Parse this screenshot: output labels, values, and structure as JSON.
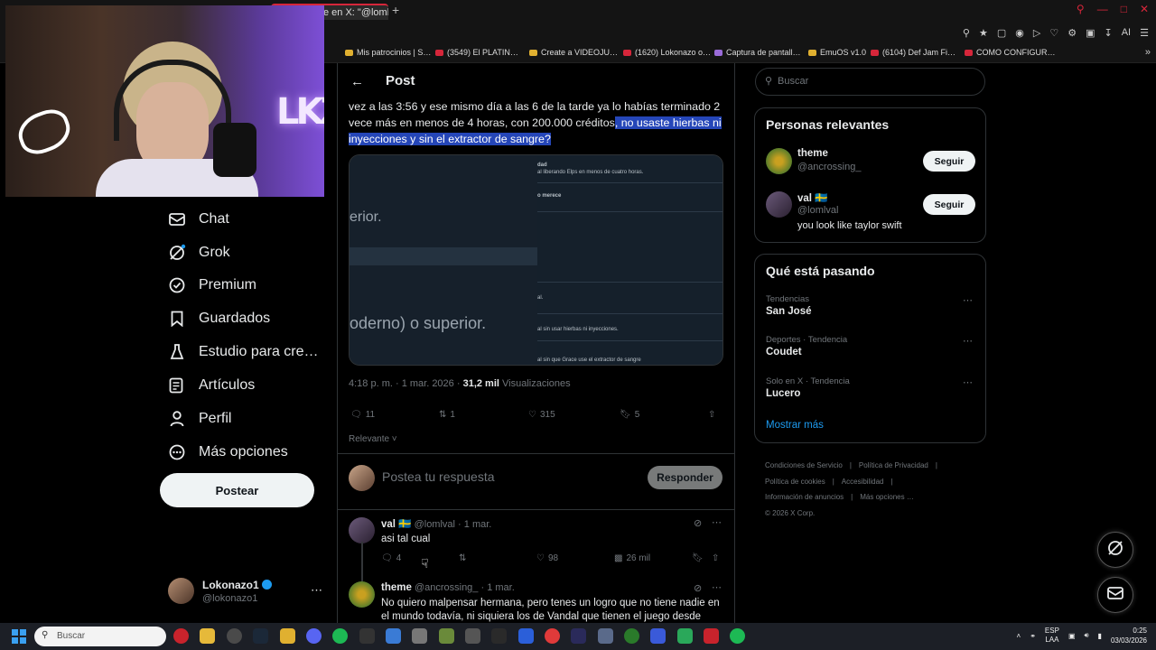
{
  "browser": {
    "active_tab_title": "e en X: \"@lomlv…",
    "new_tab": "+",
    "bookmarks": [
      "Mis patrocinios | S…",
      "(3549) El PLATIN…",
      "Create a VIDEOJU…",
      "(1620) Lokonazo o…",
      "Captura de pantall…",
      "EmuOS v1.0",
      "(6104) Def Jam Fi…",
      "COMO CONFIGUR…"
    ],
    "toolbar_ai": "AI"
  },
  "webcam": {
    "neon_sign": "LKZ"
  },
  "nav": {
    "items": [
      {
        "label": "Chat",
        "icon": "mail-icon"
      },
      {
        "label": "Grok",
        "icon": "grok-icon"
      },
      {
        "label": "Premium",
        "icon": "verified-badge-icon"
      },
      {
        "label": "Guardados",
        "icon": "bookmark-icon"
      },
      {
        "label": "Estudio para cre…",
        "icon": "flask-icon"
      },
      {
        "label": "Artículos",
        "icon": "article-icon"
      },
      {
        "label": "Perfil",
        "icon": "person-icon"
      },
      {
        "label": "Más opciones",
        "icon": "more-circle-icon"
      }
    ],
    "post_button": "Postear",
    "account": {
      "name": "Lokonazo1",
      "handle": "@lokonazo1",
      "more": "⋯"
    }
  },
  "post": {
    "title": "Post",
    "text_plain": "vez a las 3:56 y ese mismo día a las 6 de la tarde ya lo habías terminado 2 vece más en menos de 4 horas, con 200.000 créditos",
    "text_highlighted": ", no usaste hierbas ni inyecciones y sin el extractor de sangre?",
    "media": {
      "left_text_1": "erior.",
      "left_text_2": "oderno) o superior.",
      "right_lines": [
        "dad",
        "al liberando Elps en menos de cuatro horas.",
        "o merece",
        "al.",
        "al sin usar hierbas ni inyecciones.",
        "al sin que Grace use el extractor de sangre"
      ]
    },
    "time": "4:18 p. m. · 1 mar. 2026 ·",
    "views_count": "31,2 mil",
    "views_label": "Visualizaciones",
    "actions": {
      "replies": "11",
      "reposts": "1",
      "likes": "315",
      "bookmarks": "5"
    },
    "sort_label": "Relevante"
  },
  "reply_box": {
    "placeholder": "Postea tu respuesta",
    "button": "Responder"
  },
  "replies": [
    {
      "name": "val 🇸🇪",
      "handle": "@lomlval",
      "date": "· 1 mar.",
      "text": "asi tal cual",
      "replies": "4",
      "likes": "98",
      "views": "26 mil"
    },
    {
      "name": "theme",
      "handle": "@ancrossing_",
      "date": "· 1 mar.",
      "text": "No quiero malpensar hermana, pero tenes un logro que no tiene nadie en el mundo todavía, ni siquiera los de Vandal que tienen el juego desde antes"
    }
  ],
  "sidebar": {
    "search_placeholder": "Buscar",
    "relevant_title": "Personas relevantes",
    "people": [
      {
        "name": "theme",
        "handle": "@ancrossing_",
        "bio": "",
        "follow": "Seguir"
      },
      {
        "name": "val 🇸🇪",
        "handle": "@lomlval",
        "bio": "you look like taylor swift",
        "follow": "Seguir"
      }
    ],
    "trends_title": "Qué está pasando",
    "trends": [
      {
        "context": "Tendencias",
        "topic": "San José"
      },
      {
        "context": "Deportes · Tendencia",
        "topic": "Coudet"
      },
      {
        "context": "Solo en X · Tendencia",
        "topic": "Lucero"
      }
    ],
    "show_more": "Mostrar más",
    "footer": [
      "Condiciones de Servicio",
      "|",
      "Política de Privacidad",
      "|",
      "Política de cookies",
      "|",
      "Accesibilidad",
      "|",
      "Información de anuncios",
      "|",
      "Más opciones …",
      "© 2026 X Corp."
    ]
  },
  "taskbar": {
    "search_placeholder": "Buscar",
    "lang_1": "ESP",
    "lang_2": "LAA",
    "time": "0:25",
    "date": "03/03/2026"
  },
  "colors": {
    "accent": "#1d9bf0",
    "highlight": "#2546b8",
    "browser_accent": "#d6263a"
  }
}
